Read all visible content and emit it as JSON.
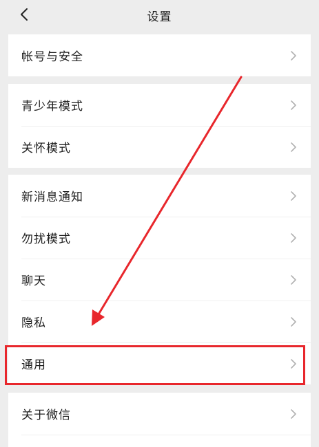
{
  "header": {
    "title": "设置",
    "back_icon": "chevron-left-icon"
  },
  "groups": [
    {
      "items": [
        {
          "label": "帐号与安全"
        }
      ]
    },
    {
      "items": [
        {
          "label": "青少年模式"
        },
        {
          "label": "关怀模式"
        }
      ]
    },
    {
      "items": [
        {
          "label": "新消息通知"
        },
        {
          "label": "勿扰模式"
        },
        {
          "label": "聊天"
        },
        {
          "label": "隐私"
        },
        {
          "label": "通用"
        }
      ]
    },
    {
      "items": [
        {
          "label": "关于微信"
        }
      ]
    }
  ],
  "annotation": {
    "color": "#e8272c",
    "highlighted_item": "通用"
  },
  "chevron_icon": "chevron-right-icon"
}
